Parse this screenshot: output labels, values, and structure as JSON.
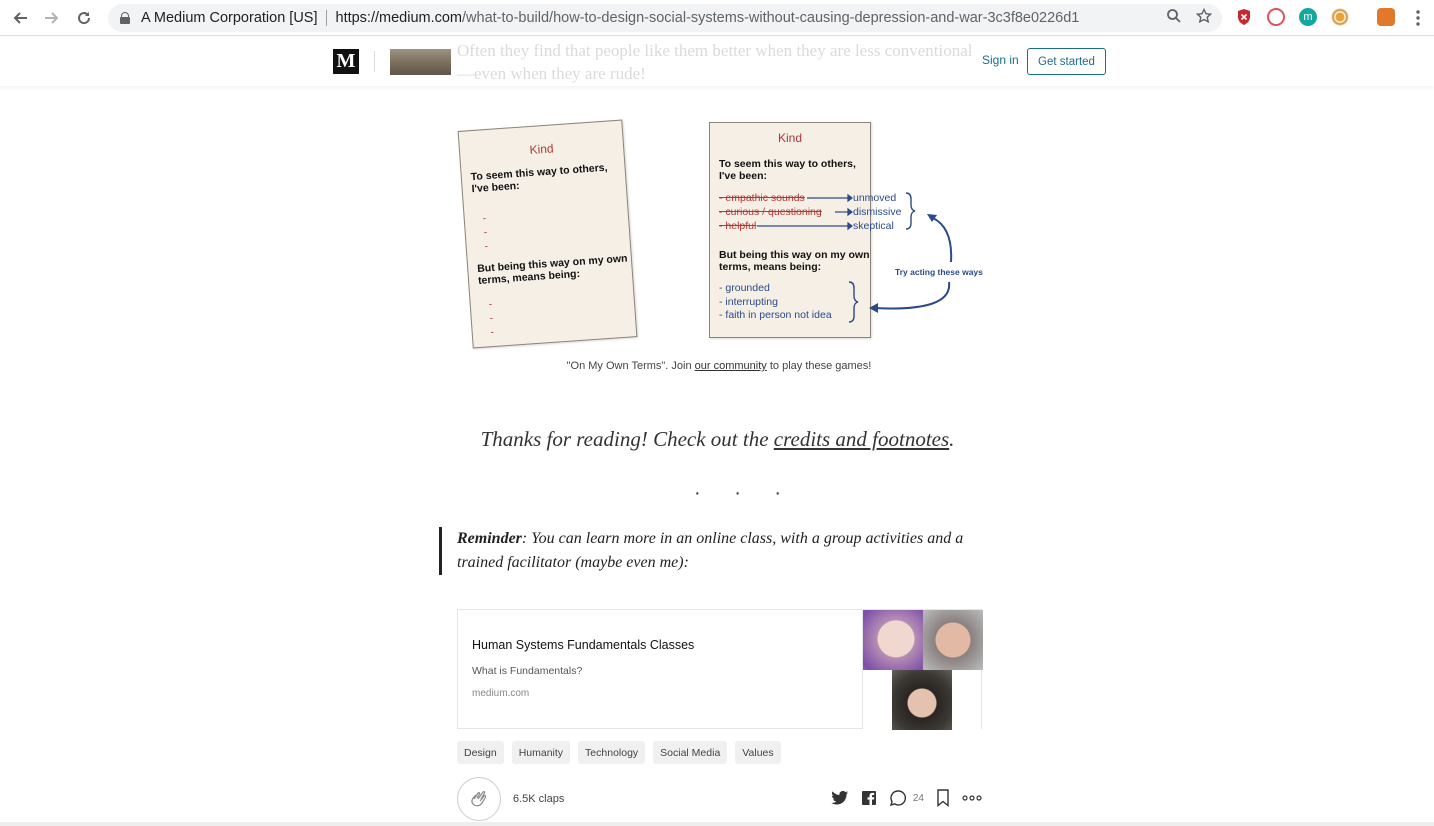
{
  "browser": {
    "site_identity": "A Medium Corporation [US]",
    "url_host": "https://medium.com",
    "url_path": "/what-to-build/how-to-design-social-systems-without-causing-depression-and-war-3c3f8e0226d1"
  },
  "header": {
    "logo_letter": "M",
    "ghost_text_line1": "Often they find that people like them better when they are less conventional",
    "ghost_text_line2": "—even when they are rude!",
    "sign_in": "Sign in",
    "get_started": "Get started"
  },
  "figure": {
    "left_card": {
      "title": "Kind",
      "prompt": "To seem this way to others, I've been:",
      "bullets": [
        "-",
        "-",
        "-"
      ],
      "second_prompt_a": "But being this way on my own",
      "second_prompt_b": "terms, means being:",
      "bullets2": [
        "-",
        "-",
        "-"
      ]
    },
    "right_card": {
      "title": "Kind",
      "prompt_l1": "To seem this way to others,",
      "prompt_l2": "I've been:",
      "crossed": [
        "- empathic sounds",
        "- curious / questioning",
        "- helpful"
      ],
      "replacements": [
        "unmoved",
        "dismissive",
        "skeptical"
      ],
      "second_prompt_l1": "But being this way on my own",
      "second_prompt_l2": "terms, means being:",
      "own_terms": [
        "- grounded",
        "- interrupting",
        "- faith in person not idea"
      ]
    },
    "arrow_label": "Try acting these ways",
    "caption_pre": "\"On My Own Terms\". Join ",
    "caption_link": "our community",
    "caption_post": " to play these games!"
  },
  "thanks": {
    "pre": "Thanks for reading! Check out the ",
    "link": "credits and footnotes",
    "post": "."
  },
  "separator": "· · ·",
  "reminder": {
    "bold": "Reminder",
    "text": ": You can learn more in an online class, with a group activities and a trained facilitator (maybe even me):"
  },
  "embed": {
    "title": "Human Systems Fundamentals Classes",
    "subtitle": "What is Fundamentals?",
    "host": "medium.com"
  },
  "tags": [
    "Design",
    "Humanity",
    "Technology",
    "Social Media",
    "Values"
  ],
  "footer": {
    "claps": "6.5K claps",
    "responses": "24"
  }
}
